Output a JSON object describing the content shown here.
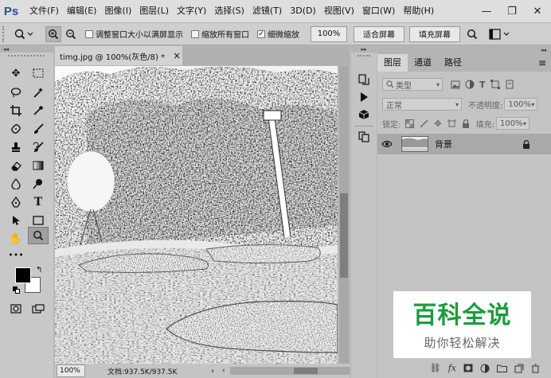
{
  "app": {
    "logo": "Ps"
  },
  "menu": [
    "文件(F)",
    "编辑(E)",
    "图像(I)",
    "图层(L)",
    "文字(Y)",
    "选择(S)",
    "滤镜(T)",
    "3D(D)",
    "视图(V)",
    "窗口(W)",
    "帮助(H)"
  ],
  "window_controls": {
    "minimize": "—",
    "restore": "❐",
    "close": "✕"
  },
  "options": {
    "resize_windows_label": "调整窗口大小以满屏显示",
    "zoom_all_label": "缩放所有窗口",
    "scrubby_zoom_label": "细微缩放",
    "zoom_percent": "100%",
    "fit_screen_label": "适合屏幕",
    "fill_screen_label": "填充屏幕",
    "resize_windows_checked": false,
    "zoom_all_checked": false,
    "scrubby_zoom_checked": true
  },
  "document": {
    "tab_title": "timg.jpg @ 100%(灰色/8) *",
    "tab_close": "×",
    "status_zoom": "100%",
    "status_doc": "文档:937.5K/937.5K"
  },
  "panel": {
    "tabs": [
      "图层",
      "通道",
      "路径"
    ],
    "active_tab": 0,
    "filter_kind": "类型",
    "blend_mode": "正常",
    "opacity_label": "不透明度:",
    "opacity_value": "100%",
    "lock_label": "锁定:",
    "fill_label": "填充:",
    "fill_value": "100%",
    "layers": [
      {
        "name": "背景",
        "visible": true,
        "locked": true
      }
    ]
  },
  "watermark": {
    "title": "百科全说",
    "subtitle": "助你轻松解决"
  },
  "colors": {
    "logo": "#27518f",
    "watermark_title": "#1a9c3e",
    "foreground": "#000000",
    "background": "#ffffff"
  }
}
